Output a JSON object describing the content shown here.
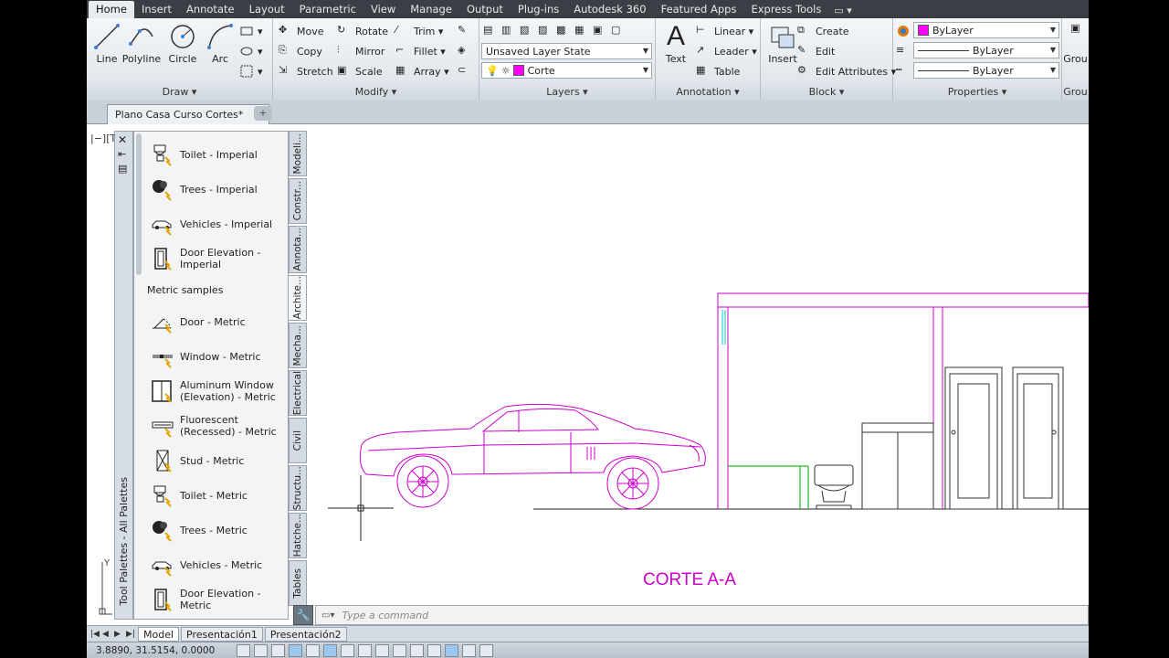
{
  "ribbon_tabs": [
    "Home",
    "Insert",
    "Annotate",
    "Layout",
    "Parametric",
    "View",
    "Manage",
    "Output",
    "Plug-ins",
    "Autodesk 360",
    "Featured Apps",
    "Express Tools"
  ],
  "active_tab": "Home",
  "draw": {
    "title": "Draw",
    "line": "Line",
    "polyline": "Polyline",
    "circle": "Circle",
    "arc": "Arc"
  },
  "modify": {
    "title": "Modify",
    "move": "Move",
    "copy": "Copy",
    "stretch": "Stretch",
    "rotate": "Rotate",
    "mirror": "Mirror",
    "scale": "Scale",
    "trim": "Trim",
    "fillet": "Fillet",
    "array": "Array"
  },
  "layers": {
    "title": "Layers",
    "layer_state": "Unsaved Layer State",
    "current_layer": "Corte",
    "layer_color": "#ff00ff"
  },
  "annotation": {
    "title": "Annotation",
    "text": "Text",
    "linear": "Linear",
    "leader": "Leader",
    "table": "Table"
  },
  "block": {
    "title": "Block",
    "insert": "Insert",
    "create": "Create",
    "edit": "Edit",
    "edit_attributes": "Edit Attributes"
  },
  "properties": {
    "title": "Properties",
    "color": "ByLayer",
    "lineweight": "ByLayer",
    "linetype": "ByLayer",
    "color_swatch": "#ff00ff"
  },
  "group": {
    "title": "Grou",
    "button": "Grou"
  },
  "document": {
    "tab": "Plano Casa Curso Cortes*"
  },
  "palette": {
    "title": "Tool Palettes - All Palettes",
    "section_header": "Metric samples",
    "items_top": [
      {
        "label": "Toilet - Imperial",
        "icon": "toilet-icon"
      },
      {
        "label": "Trees - Imperial",
        "icon": "tree-icon"
      },
      {
        "label": "Vehicles - Imperial",
        "icon": "car-icon"
      },
      {
        "label": "Door Elevation - Imperial",
        "icon": "door-icon"
      }
    ],
    "items_metric": [
      {
        "label": "Door - Metric",
        "icon": "door-swing-icon"
      },
      {
        "label": "Window - Metric",
        "icon": "window-icon"
      },
      {
        "label": "Aluminum Window (Elevation) - Metric",
        "icon": "window-elevation-icon"
      },
      {
        "label": "Fluorescent (Recessed) - Metric",
        "icon": "fluorescent-icon"
      },
      {
        "label": "Stud - Metric",
        "icon": "stud-icon"
      },
      {
        "label": "Toilet - Metric",
        "icon": "toilet-icon"
      },
      {
        "label": "Trees - Metric",
        "icon": "tree-icon"
      },
      {
        "label": "Vehicles - Metric",
        "icon": "car-icon"
      },
      {
        "label": "Door Elevation - Metric",
        "icon": "door-icon"
      }
    ],
    "tabs": [
      "Modeli...",
      "Constr...",
      "Annota...",
      "Archite...",
      "Mecha...",
      "Electrical",
      "Civil",
      "Structu...",
      "Hatche...",
      "Tables"
    ],
    "active_tab": "Archite..."
  },
  "drawing": {
    "caption": "CORTE A-A",
    "caption_color": "#cc00cc"
  },
  "command": {
    "placeholder": "Type a command"
  },
  "layout_tabs": [
    "Model",
    "Presentación1",
    "Presentación2"
  ],
  "status": {
    "coordinates": "3.8890, 31.5154, 0.0000"
  }
}
